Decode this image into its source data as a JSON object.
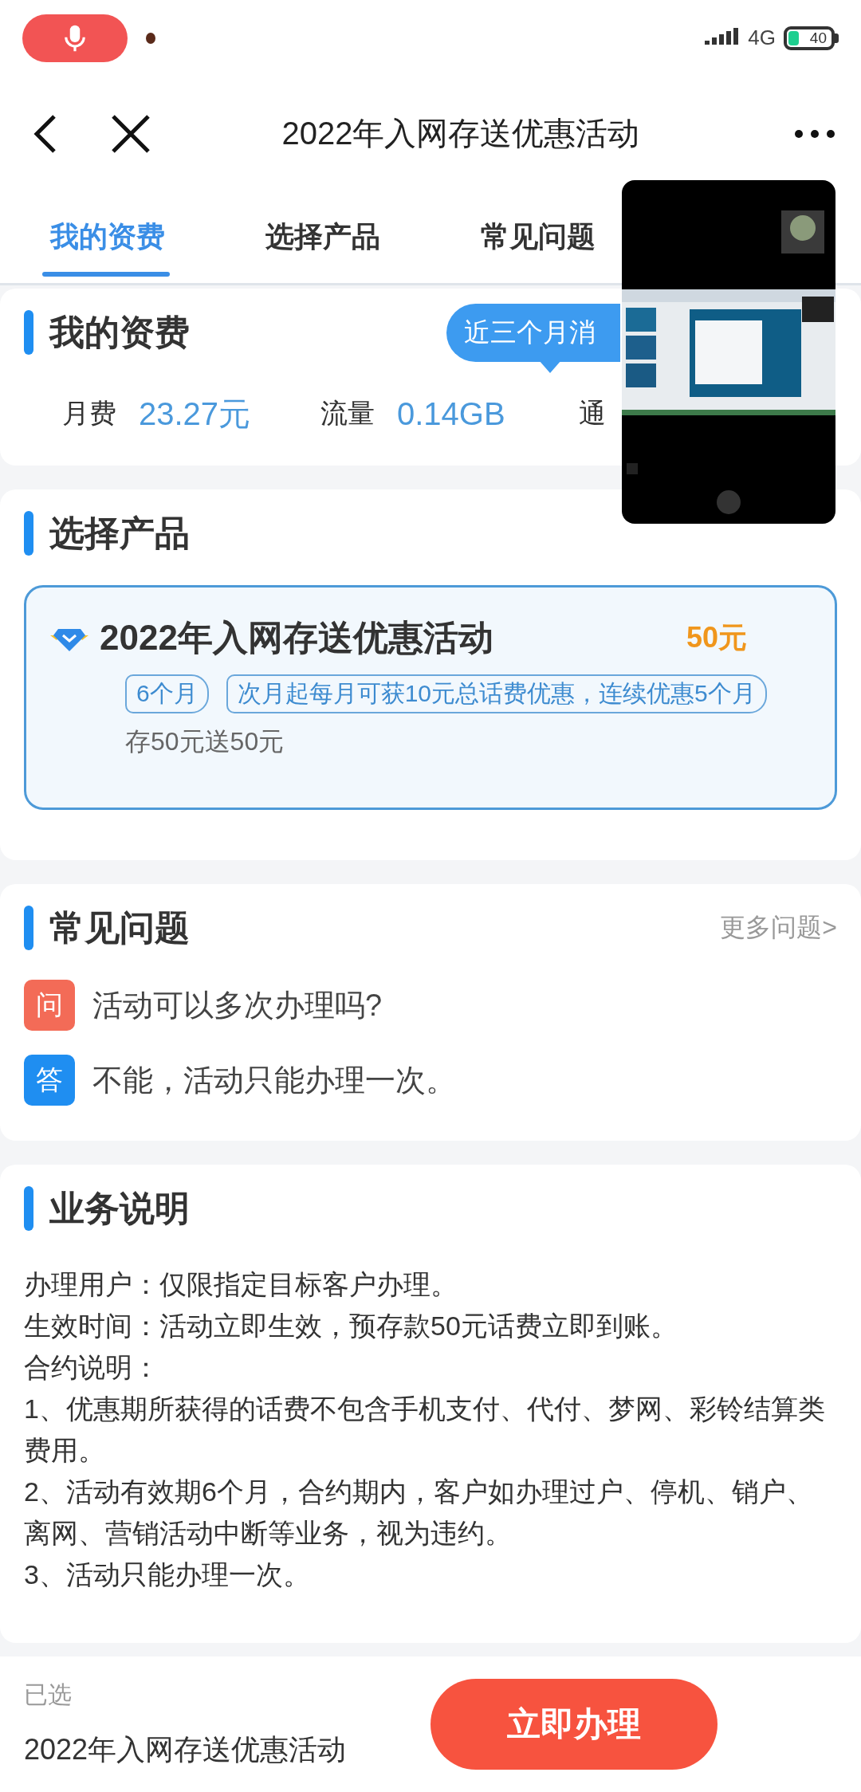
{
  "status_bar": {
    "network": "4G",
    "battery": "40"
  },
  "nav": {
    "title": "2022年入网存送优惠活动"
  },
  "tabs": [
    {
      "label": "我的资费",
      "selected": true
    },
    {
      "label": "选择产品",
      "selected": false
    },
    {
      "label": "常见问题",
      "selected": false
    }
  ],
  "tariff": {
    "title": "我的资费",
    "bubble": "近三个月消",
    "stats": [
      {
        "label": "月费",
        "value": "23.27元"
      },
      {
        "label": "流量",
        "value": "0.14GB"
      },
      {
        "label": "通"
      }
    ]
  },
  "products": {
    "title": "选择产品",
    "items": [
      {
        "name": "2022年入网存送优惠活动",
        "price": "50元",
        "tags": [
          "6个月",
          "次月起每月可获10元总话费优惠，连续优惠5个月"
        ],
        "desc": "存50元送50元",
        "selected": true
      }
    ]
  },
  "faq": {
    "title": "常见问题",
    "more": "更多问题>",
    "items": [
      {
        "kind": "question",
        "badge": "问",
        "text": "活动可以多次办理吗?"
      },
      {
        "kind": "answer",
        "badge": "答",
        "text": "不能，活动只能办理一次。"
      }
    ]
  },
  "terms": {
    "title": "业务说明",
    "lines": [
      "办理用户：仅限指定目标客户办理。",
      "生效时间：活动立即生效，预存款50元话费立即到账。",
      "合约说明：",
      "1、优惠期所获得的话费不包含手机支付、代付、梦网、彩铃结算类费用。",
      "2、活动有效期6个月，合约期内，客户如办理过户、停机、销户、离网、营销活动中断等业务，视为违约。",
      "3、活动只能办理一次。"
    ]
  },
  "footer": {
    "label": "已选",
    "selection": "2022年入网存送优惠活动",
    "button": "立即办理"
  }
}
